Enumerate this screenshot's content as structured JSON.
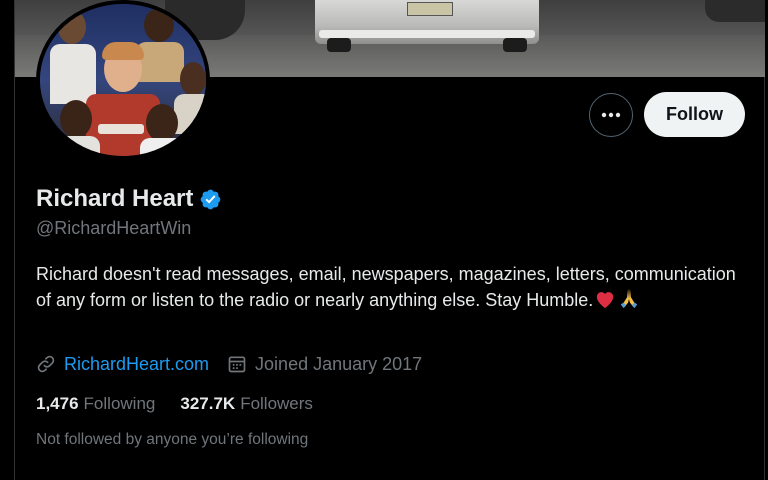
{
  "profile": {
    "display_name": "Richard Heart",
    "verified_icon": "verified-badge-icon",
    "handle": "@RichardHeartWin",
    "bio_text": "Richard doesn't read messages, email, newspapers, magazines, letters, communication of any form or listen to the radio or nearly anything else. Stay Humble.",
    "bio_emojis": [
      "red-heart",
      "folded-hands"
    ],
    "website": "RichardHeart.com",
    "joined": "Joined January 2017",
    "following_count": "1,476",
    "following_label": "Following",
    "followers_count": "327.7K",
    "followers_label": "Followers",
    "mutuals_text": "Not followed by anyone you’re following"
  },
  "actions": {
    "more_icon": "more-dots-icon",
    "follow_label": "Follow"
  },
  "colors": {
    "background": "#000000",
    "primary_text": "#e7e9ea",
    "secondary_text": "#71767b",
    "link": "#1d9bf0",
    "follow_button_bg": "#eff3f4",
    "verified": "#1d9bf0"
  }
}
